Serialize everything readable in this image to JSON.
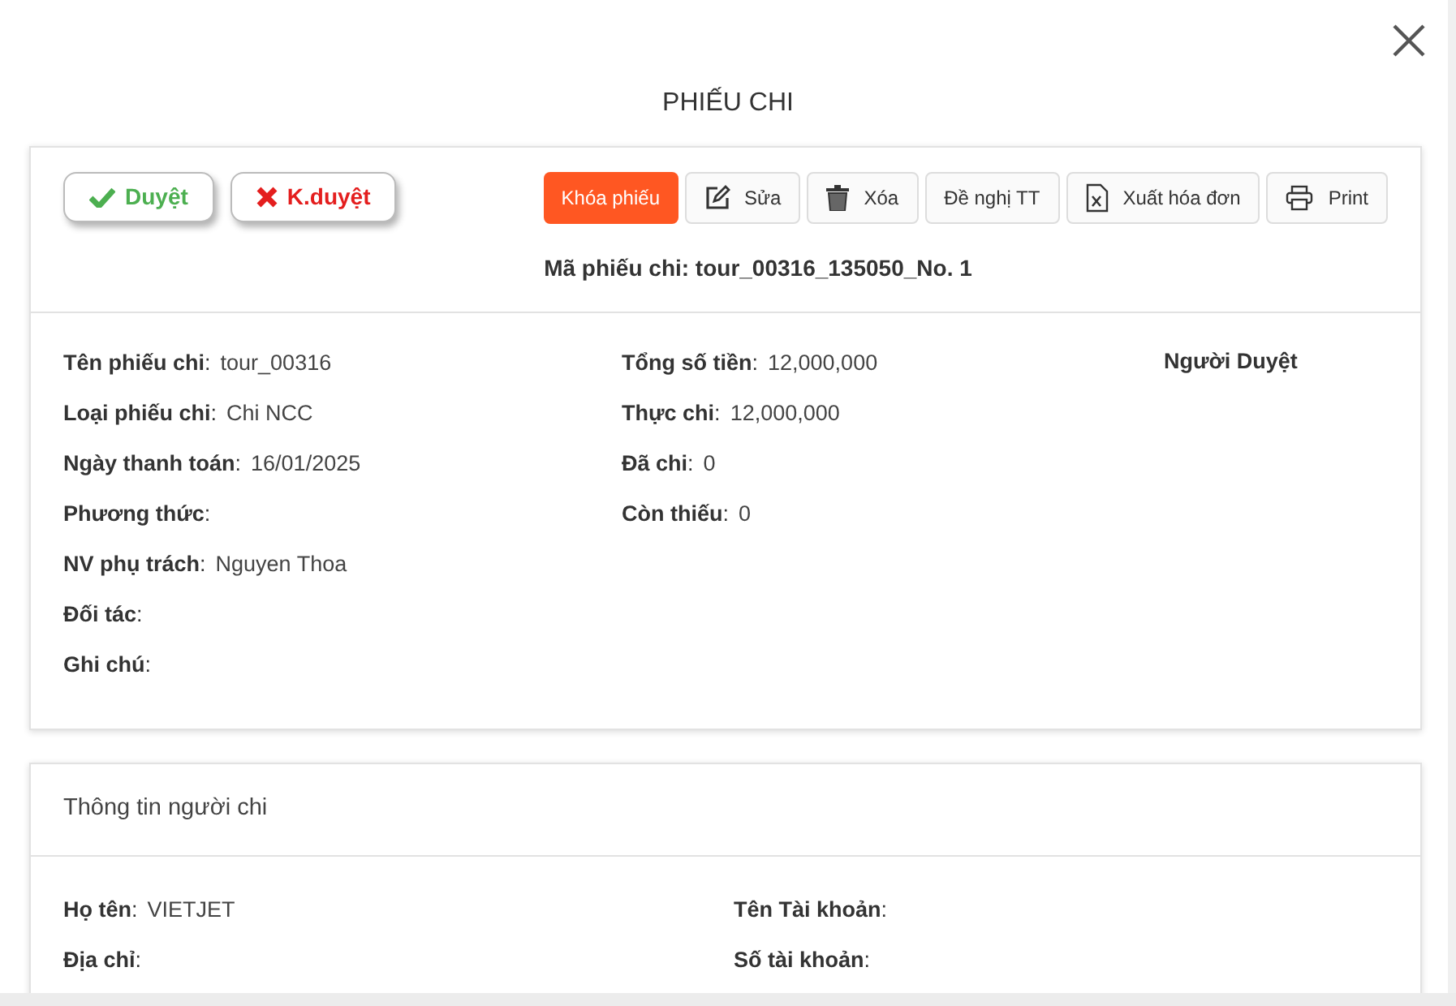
{
  "title": "PHIẾU CHI",
  "approval_buttons": [
    {
      "label": "Duyệt",
      "kind": "approve"
    },
    {
      "label": "K.duyệt",
      "kind": "reject"
    }
  ],
  "toolbar": [
    {
      "label": "Khóa phiếu",
      "kind": "primary"
    },
    {
      "label": "Sửa",
      "kind": "edit"
    },
    {
      "label": "Xóa",
      "kind": "delete"
    },
    {
      "label": "Đề nghị TT",
      "kind": "plain"
    },
    {
      "label": "Xuất hóa đơn",
      "kind": "excel"
    },
    {
      "label": "Print",
      "kind": "print"
    }
  ],
  "voucher_code": "Mã phiếu chi: tour_00316_135050_No. 1",
  "details_left": [
    {
      "label": "**Tên phiếu chi**:",
      "value": "tour_00316"
    },
    {
      "label": "**Loại phiếu chi**:",
      "value": "Chi NCC"
    },
    {
      "label": "**Ngày thanh toán**:",
      "value": "16/01/2025"
    },
    {
      "label": "**Phương thức**:"
    },
    {
      "label": "**NV phụ trách**:",
      "value": "Nguyen Thoa"
    },
    {
      "label": "**Đối tác**:"
    },
    {
      "label": "**Ghi chú**:"
    }
  ],
  "details_middle": [
    {
      "label": "**Tổng số tiền**:",
      "value": "12,000,000"
    },
    {
      "label": "**Thực chi**:",
      "value": "12,000,000"
    },
    {
      "label": "**Đã chi**:",
      "value": "0"
    },
    {
      "label": "**Còn thiếu**:",
      "value": "0"
    }
  ],
  "approver_heading": "Người Duyệt",
  "payee": {
    "heading": "Thông tin người chi",
    "left": [
      {
        "label": "**Họ tên**:",
        "value": "VIETJET"
      },
      {
        "label": "**Địa chỉ**:"
      }
    ],
    "right": [
      {
        "label": "**Tên Tài khoản**:"
      },
      {
        "label": "**Số tài khoản**:"
      }
    ]
  }
}
